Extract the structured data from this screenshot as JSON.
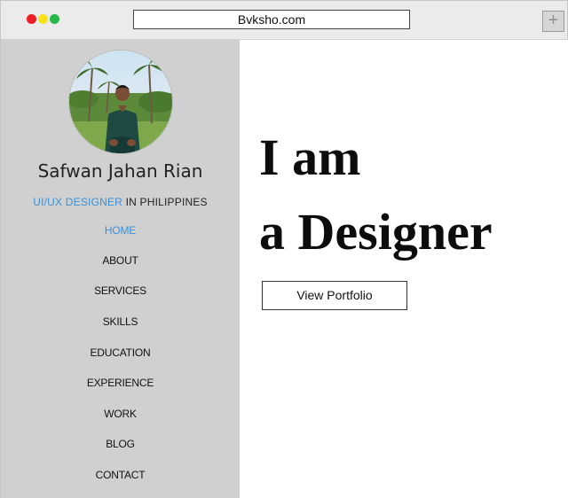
{
  "browser": {
    "url": "Bvksho.com",
    "new_tab_glyph": "+",
    "traffic_lights": {
      "close": "#ee1c24",
      "minimize": "#f8e21a",
      "maximize": "#27b84a"
    }
  },
  "profile": {
    "name": "Safwan Jahan Rian",
    "role_accent": "UI/UX DESIGNER",
    "role_rest": " IN PHILIPPINES",
    "accent_color": "#3a8fd6"
  },
  "nav": {
    "items": [
      {
        "label": "HOME",
        "active": true
      },
      {
        "label": "ABOUT",
        "active": false
      },
      {
        "label": "SERVICES",
        "active": false
      },
      {
        "label": "SKILLS",
        "active": false
      },
      {
        "label": "EDUCATION",
        "active": false
      },
      {
        "label": "EXPERIENCE",
        "active": false
      },
      {
        "label": "WORK",
        "active": false
      },
      {
        "label": "BLOG",
        "active": false
      },
      {
        "label": "CONTACT",
        "active": false
      }
    ]
  },
  "hero": {
    "line1": "I am",
    "line2": "a Designer",
    "button_label": "View Portfolio"
  }
}
